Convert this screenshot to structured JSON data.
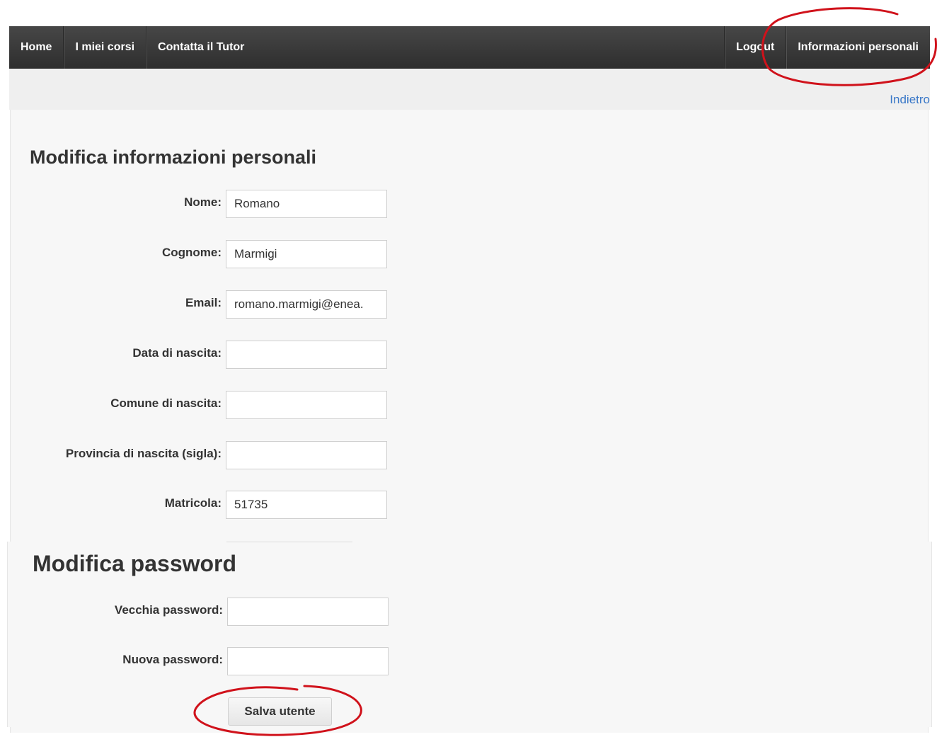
{
  "nav": {
    "left": [
      {
        "label": "Home"
      },
      {
        "label": "I miei corsi"
      },
      {
        "label": "Contatta il Tutor"
      }
    ],
    "right": [
      {
        "label": "Logout"
      },
      {
        "label": "Informazioni personali"
      }
    ]
  },
  "back_link": "Indietro",
  "info_section": {
    "title": "Modifica informazioni personali",
    "fields": [
      {
        "label": "Nome:",
        "value": "Romano"
      },
      {
        "label": "Cognome:",
        "value": "Marmigi"
      },
      {
        "label": "Email:",
        "value": "romano.marmigi@enea."
      },
      {
        "label": "Data di nascita:",
        "value": ""
      },
      {
        "label": "Comune di nascita:",
        "value": ""
      },
      {
        "label": "Provincia di nascita (sigla):",
        "value": ""
      },
      {
        "label": "Matricola:",
        "value": "51735"
      }
    ]
  },
  "password_section": {
    "title": "Modifica password",
    "fields": [
      {
        "label": "Vecchia password:",
        "value": ""
      },
      {
        "label": "Nuova password:",
        "value": ""
      }
    ]
  },
  "save_button": "Salva utente",
  "colors": {
    "navbar": "#3a3a3a",
    "link": "#3a78c8",
    "annotation": "#d0121b"
  }
}
